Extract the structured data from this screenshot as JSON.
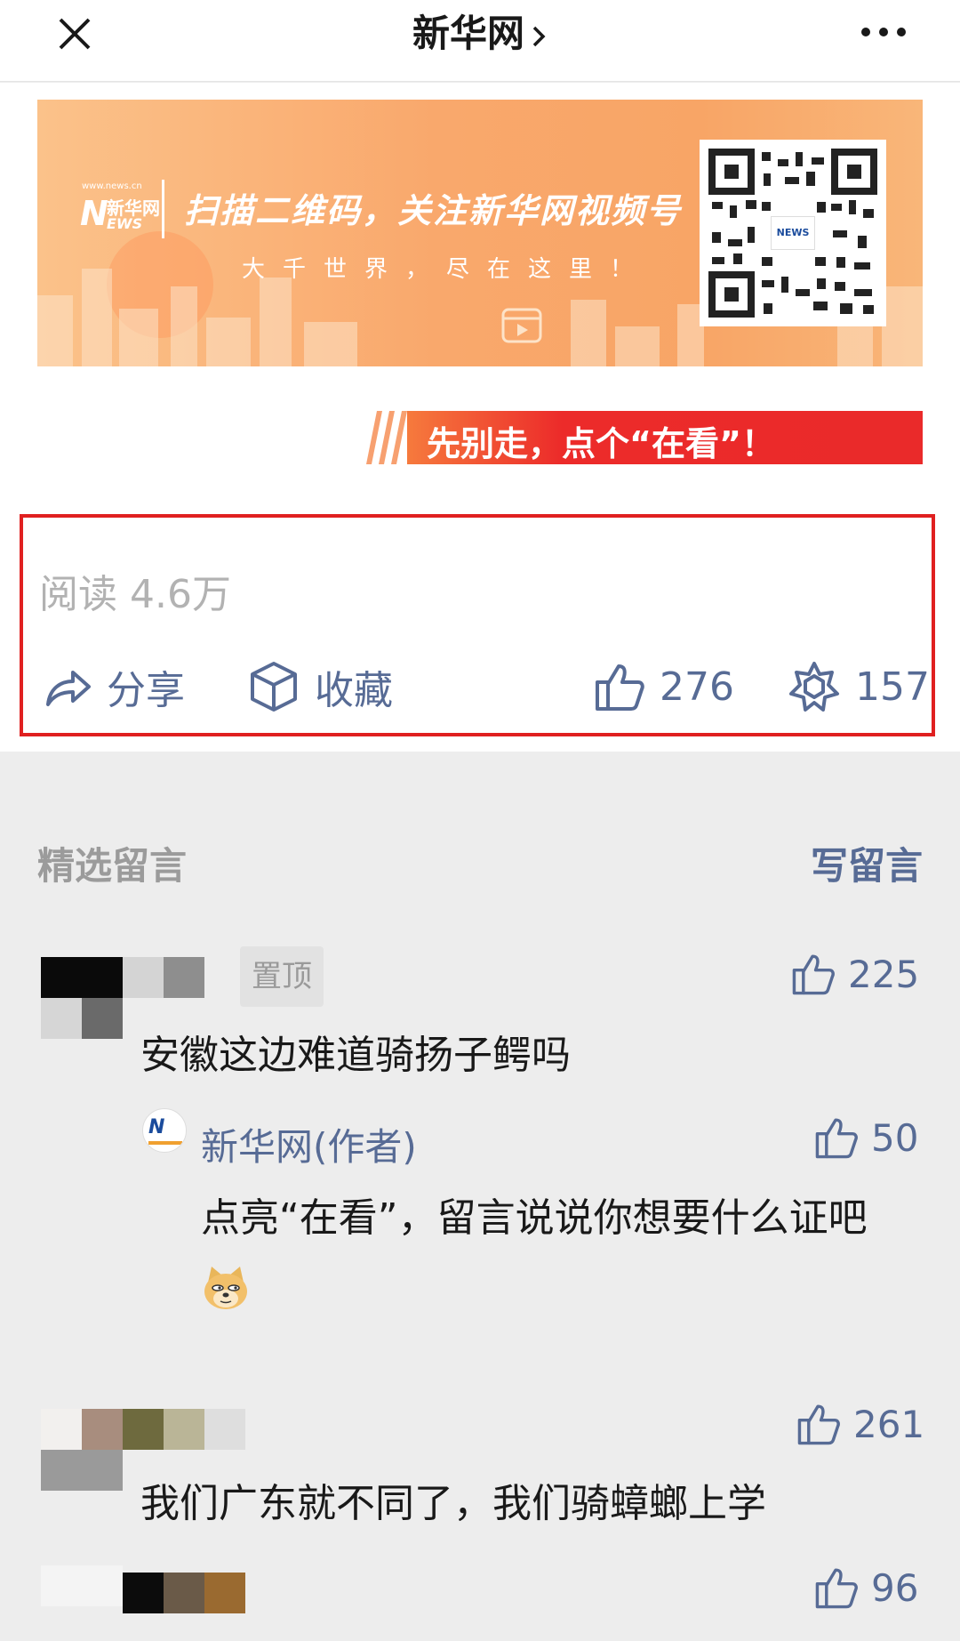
{
  "topbar": {
    "title": "新华网"
  },
  "banner": {
    "logo_small": "www.news.cn",
    "logo_cn": "新华网",
    "logo_en": "EWS",
    "headline": "扫描二维码，关注新华网视频号",
    "subline": "大千世界，尽在这里！",
    "qr_logo": "NEWS"
  },
  "stay": {
    "text": "先别走，点个“在看”！"
  },
  "stats": {
    "reads": "阅读 4.6万",
    "share_label": "分享",
    "collect_label": "收藏",
    "likes": "276",
    "wows": "157"
  },
  "comments_section": {
    "title": "精选留言",
    "write_label": "写留言"
  },
  "comments": [
    {
      "pinned_label": "置顶",
      "likes": "225",
      "text": "安徽这边难道骑扬子鳄吗",
      "reply": {
        "name": "新华网(作者)",
        "likes": "50",
        "text": "点亮“在看”，留言说说你想要什么证吧"
      }
    },
    {
      "likes": "261",
      "text": "我们广东就不同了，我们骑蟑螂上学"
    },
    {
      "likes": "96"
    }
  ],
  "colors": {
    "link_blue": "#576b95",
    "highlight_red": "#e02020",
    "banner_orange": "#f9a86c"
  }
}
